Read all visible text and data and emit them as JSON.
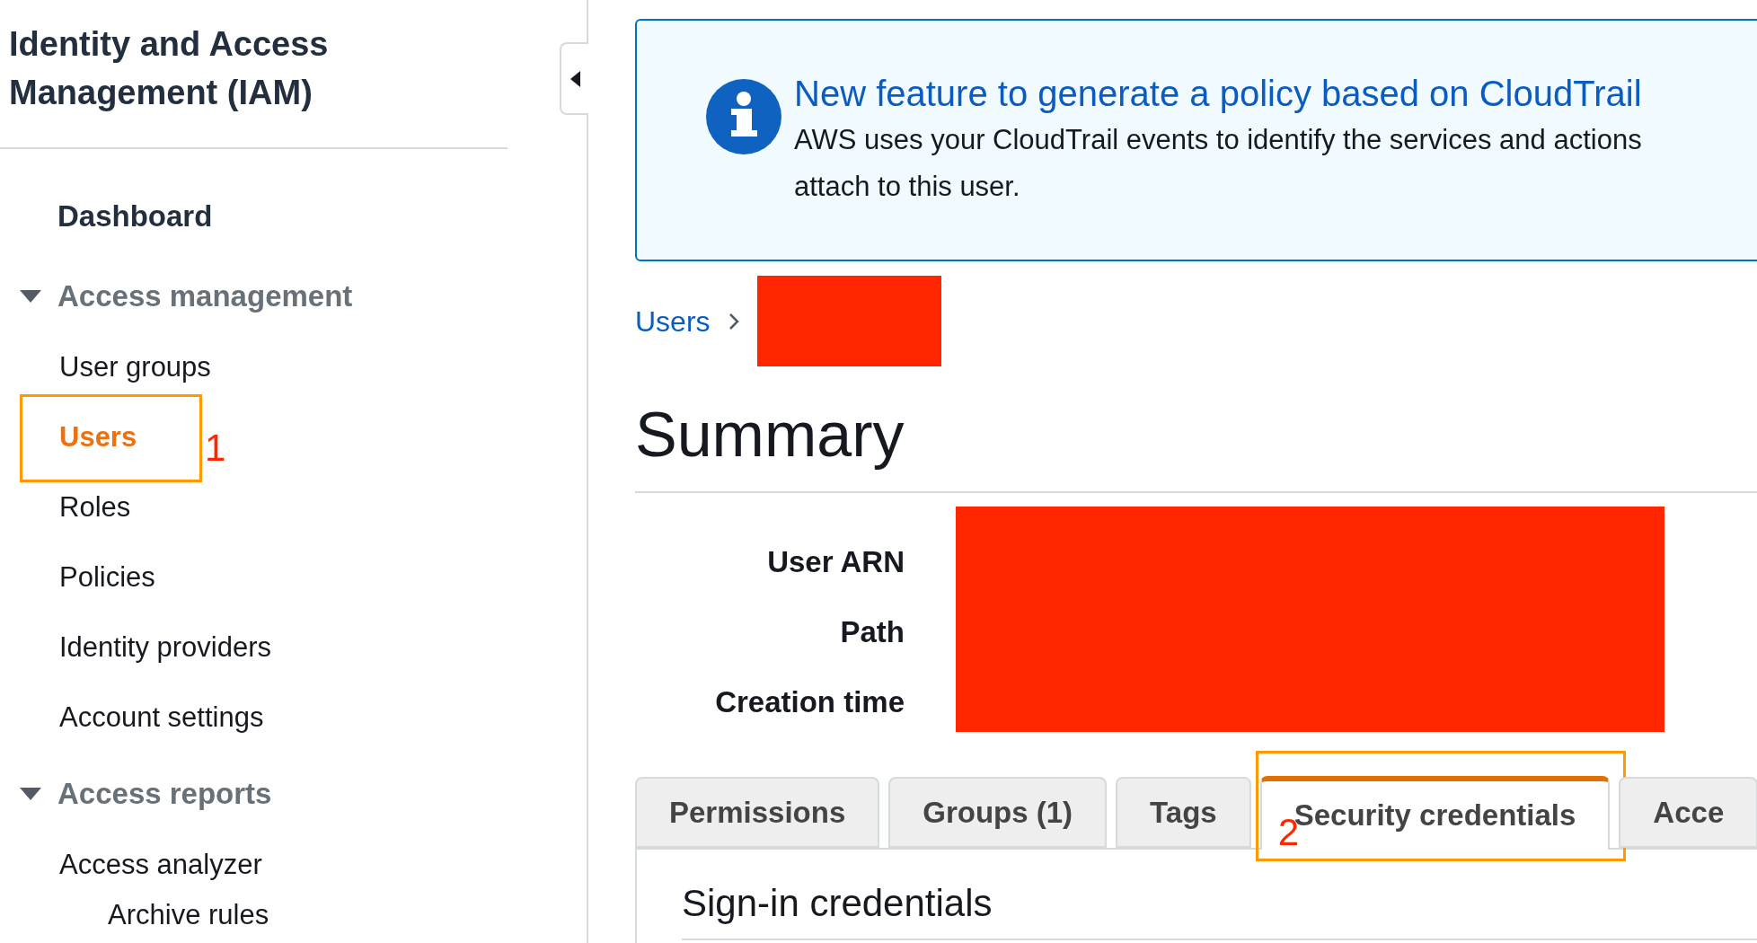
{
  "sidebar": {
    "title_lines": [
      "Identity and Access",
      "Management (IAM)"
    ],
    "items": [
      {
        "kind": "link",
        "label": "Dashboard",
        "bold": true,
        "selected": false
      },
      {
        "kind": "section",
        "label": "Access management",
        "expanded": true,
        "children": [
          {
            "label": "User groups",
            "selected": false
          },
          {
            "label": "Users",
            "selected": true
          },
          {
            "label": "Roles",
            "selected": false
          },
          {
            "label": "Policies",
            "selected": false
          },
          {
            "label": "Identity providers",
            "selected": false
          },
          {
            "label": "Account settings",
            "selected": false
          }
        ]
      },
      {
        "kind": "section",
        "label": "Access reports",
        "expanded": true,
        "children": [
          {
            "label": "Access analyzer",
            "selected": false,
            "children": [
              {
                "label": "Archive rules",
                "selected": false
              }
            ]
          }
        ]
      }
    ]
  },
  "banner": {
    "title": "New feature to generate a policy based on CloudTrail",
    "body_lines": [
      "AWS uses your CloudTrail events to identify the services and actions",
      "attach to this user."
    ]
  },
  "breadcrumb": {
    "link": "Users",
    "current_redacted": true
  },
  "heading": "Summary",
  "summary_fields": [
    {
      "label": "User ARN"
    },
    {
      "label": "Path"
    },
    {
      "label": "Creation time"
    }
  ],
  "tabs": [
    {
      "label": "Permissions",
      "selected": false
    },
    {
      "label": "Groups (1)",
      "selected": false
    },
    {
      "label": "Tags",
      "selected": false
    },
    {
      "label": "Security credentials",
      "selected": true
    },
    {
      "label": "Acce",
      "selected": false
    }
  ],
  "section_title": "Sign-in credentials",
  "annotations": [
    {
      "number": "1"
    },
    {
      "number": "2"
    }
  ]
}
